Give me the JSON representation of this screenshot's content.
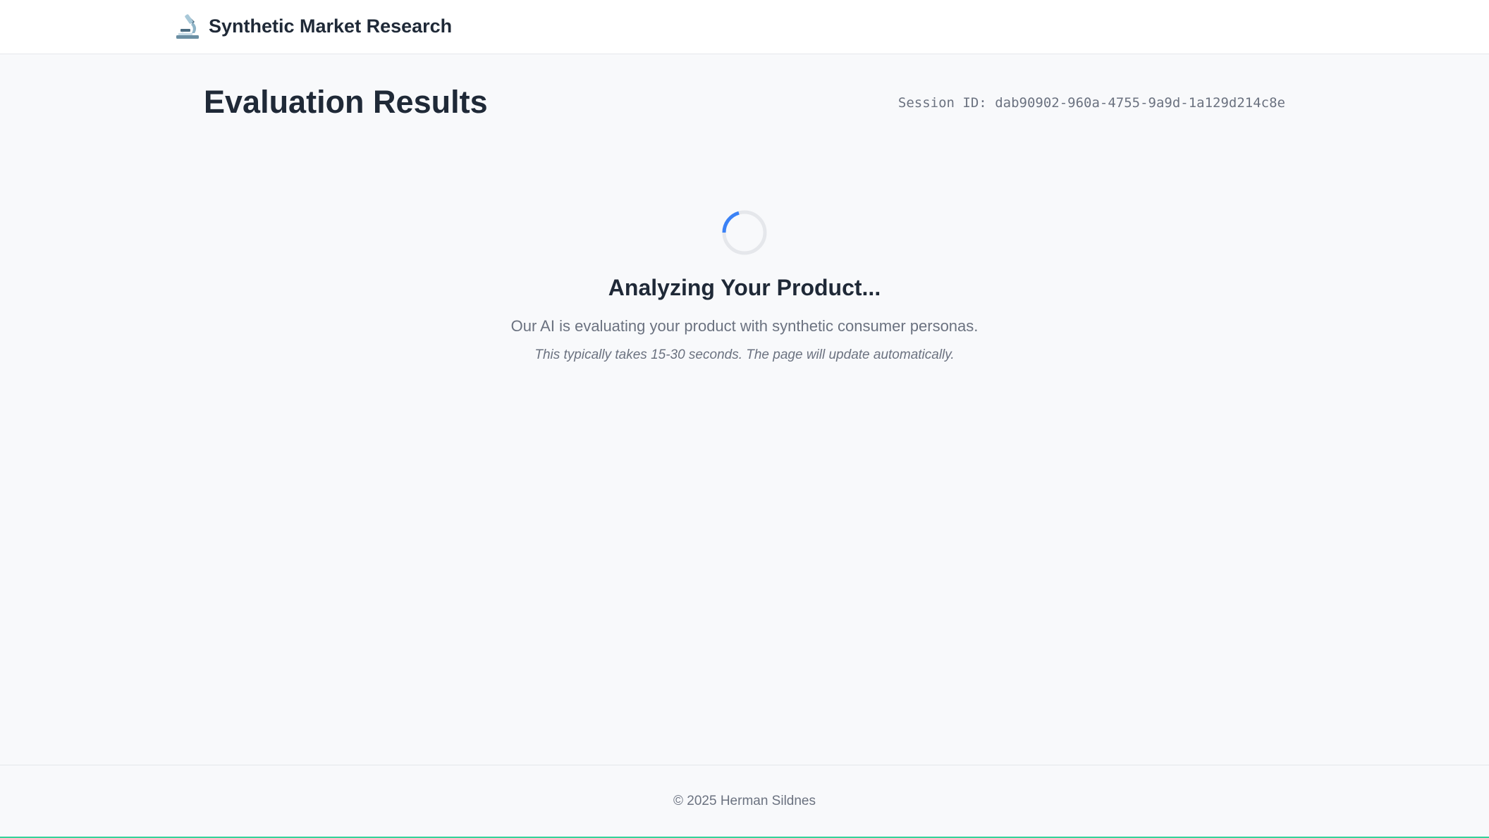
{
  "header": {
    "app_name": "Synthetic Market Research",
    "logo_icon": "microscope-icon"
  },
  "page": {
    "title": "Evaluation Results",
    "session_label": "Session ID: dab90902-960a-4755-9a9d-1a129d214c8e"
  },
  "loading": {
    "spinner_icon": "loading-spinner-icon",
    "spinner_color": "#3b82f6",
    "title": "Analyzing Your Product...",
    "message": "Our AI is evaluating your product with synthetic consumer personas.",
    "note": "This typically takes 15-30 seconds. The page will update automatically."
  },
  "footer": {
    "copyright": "© 2025 Herman Sildnes"
  },
  "colors": {
    "background": "#f8f9fb",
    "text_primary": "#1f2937",
    "text_secondary": "#6b7280",
    "accent": "#3b82f6",
    "footer_accent": "#34d399"
  }
}
